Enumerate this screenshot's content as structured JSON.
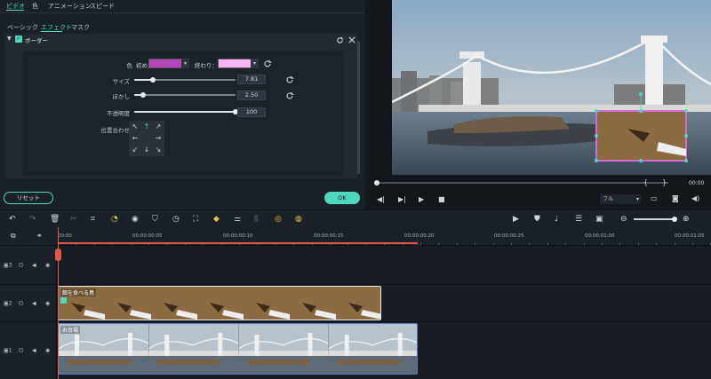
{
  "tabs": [
    {
      "label": "ビデオ",
      "active": true
    },
    {
      "label": "色"
    },
    {
      "label": "アニメーション"
    },
    {
      "label": "スピード"
    }
  ],
  "subtabs": [
    {
      "label": "ベーシック"
    },
    {
      "label": "エフェクト",
      "active": true
    },
    {
      "label": "マスク"
    }
  ],
  "effect": {
    "name": "ボーダー",
    "checked": true,
    "color_label": "色",
    "start_label": "初め:",
    "end_label": "終わり：",
    "start_color": "#b345b6",
    "end_color": "#f7b6f3",
    "size_label": "サイズ",
    "size_value": "7.81",
    "size_level": 0.18,
    "blur_label": "ぼかし",
    "blur_value": "2.50",
    "blur_level": 0.09,
    "opacity_label": "不透明度",
    "opacity_value": "100",
    "opacity_level": 1.0,
    "position_label": "位置合わせ"
  },
  "buttons": {
    "reset": "リセット",
    "ok": "OK"
  },
  "preview": {
    "zoom": "フル",
    "progress": 0.0,
    "timecode": "00:00"
  },
  "timeline": {
    "ruler": [
      "00:00",
      "00:00:00:05",
      "00:00:00:10",
      "00:00:00:15",
      "00:00:00:20",
      "00:00:00:25",
      "00:00:01:00",
      "00:00:01:05"
    ],
    "tracks": [
      {
        "num": "3",
        "clip": null
      },
      {
        "num": "2",
        "clip": "餌を食べる鳥"
      },
      {
        "num": "1",
        "clip": "お台場"
      }
    ]
  },
  "colors": {
    "accent": "#4fd8bd",
    "playhead": "#e2574c",
    "clip_pip": "#b345b6"
  }
}
